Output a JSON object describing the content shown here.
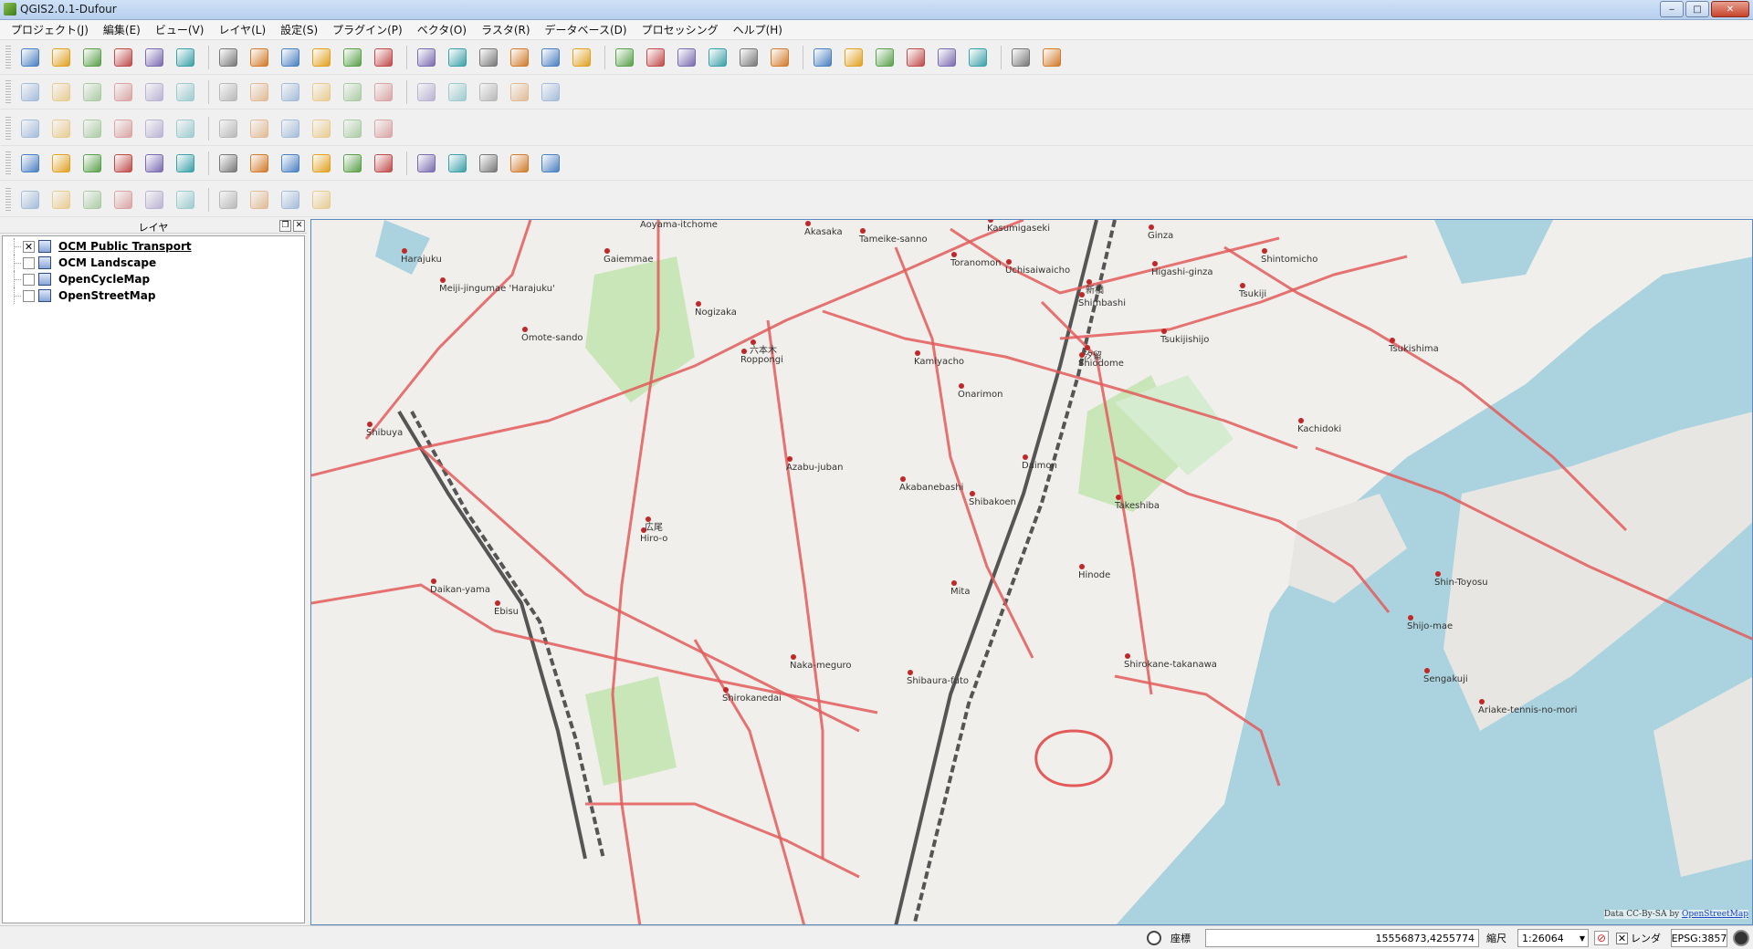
{
  "window": {
    "title": "QGIS2.0.1-Dufour",
    "minimize": "‒",
    "maximize": "□",
    "close": "✕"
  },
  "menu": [
    "プロジェクト(J)",
    "編集(E)",
    "ビュー(V)",
    "レイヤ(L)",
    "設定(S)",
    "プラグイン(P)",
    "ベクタ(O)",
    "ラスタ(R)",
    "データベース(D)",
    "プロセッシング",
    "ヘルプ(H)"
  ],
  "toolbar_icons": {
    "row1": [
      "new-project-icon",
      "open-project-icon",
      "save-project-icon",
      "save-as-icon",
      "new-print-composer-icon",
      "composer-manager-icon",
      "pan-to-selection-icon",
      "pan-icon",
      "touch-zoom-icon",
      "zoom-in-icon",
      "zoom-out-icon",
      "zoom-actual-icon",
      "zoom-full-icon",
      "zoom-to-selection-icon",
      "zoom-to-layer-icon",
      "zoom-last-icon",
      "zoom-next-icon",
      "refresh-icon",
      "identify-icon",
      "select-icon",
      "select-tools-icon",
      "deselect-icon",
      "field-calculator-icon",
      "attribute-table-icon",
      "statistics-icon",
      "measure-icon",
      "map-tips-icon",
      "new-bookmark-icon",
      "show-bookmarks-icon",
      "text-annotation-icon",
      "help-icon",
      "whats-this-icon"
    ],
    "row2": [
      "edits-icon",
      "toggle-editing-icon",
      "save-edits-icon",
      "add-feature-icon",
      "move-feature-icon",
      "node-tool-icon",
      "delete-selected-icon",
      "cut-features-icon",
      "copy-features-icon",
      "paste-features-icon",
      "label-icon",
      "layer-labeling-icon",
      "pin-labels-icon",
      "show-hide-labels-icon",
      "move-label-icon",
      "rotate-label-icon",
      "change-label-icon"
    ],
    "row3": [
      "raster-info-icon",
      "raster-hist-icon",
      "raster-stretch-icon",
      "raster-local-icon",
      "raster-bright-icon",
      "raster-dark-icon",
      "raster-contrast-icon",
      "raster-reduce-icon",
      "grid-icon",
      "sun-icon",
      "georeferencer-icon",
      "calculator-icon"
    ],
    "row4": [
      "add-vector-icon",
      "add-raster-icon",
      "add-postgis-icon",
      "add-spatialite-icon",
      "add-mssql-icon",
      "add-oracle-icon",
      "add-wms-icon",
      "add-wcs-icon",
      "add-wfs-icon",
      "add-delimited-icon",
      "new-shapefile-icon",
      "new-spatialite-icon",
      "gps-icon",
      "coordinate-capture-icon",
      "road-graph-icon",
      "globe-icon",
      "openlayers-icon"
    ],
    "row5": [
      "digitize-1-icon",
      "digitize-2-icon",
      "digitize-3-icon",
      "digitize-4-icon",
      "digitize-5-icon",
      "digitize-6-icon",
      "digitize-7-icon",
      "digitize-8-icon",
      "digitize-9-icon",
      "digitize-10-icon"
    ]
  },
  "layers_panel": {
    "title": "レイヤ",
    "layers": [
      {
        "name": "OCM Public Transport",
        "checked": true,
        "active": true
      },
      {
        "name": "OCM Landscape",
        "checked": false,
        "active": false
      },
      {
        "name": "OpenCycleMap",
        "checked": false,
        "active": false
      },
      {
        "name": "OpenStreetMap",
        "checked": false,
        "active": false
      }
    ]
  },
  "map": {
    "labels": [
      "Aoyama-itchome",
      "Akasaka",
      "Tameike-sanno",
      "Kasumigaseki",
      "Ginza",
      "Shintomicho",
      "Harajuku",
      "Gaiemmae",
      "Toranomon",
      "Uchisaiwaicho",
      "Higashi-ginza",
      "Meiji-jingumae 'Harajuku'",
      "Nogizaka",
      "Shimbashi",
      "Tsukiji",
      "Omote-sando",
      "Roppongi",
      "Tsukijishijo",
      "Tsukishima",
      "Kamiyacho",
      "Shiodome",
      "Onarimon",
      "Shibuya",
      "Kachidoki",
      "Azabu-juban",
      "Akabanebashi",
      "Daimon",
      "Shibakoen",
      "Takeshiba",
      "Hiro-o",
      "Hinode",
      "Mita",
      "Daikan-yama",
      "Shin-Toyosu",
      "Ebisu",
      "Shijo-mae",
      "Naka-meguro",
      "Shirokane-takanawa",
      "Shibaura-futo",
      "Sengakuji",
      "Ariake-tennis-no-mori",
      "Shirokanedai",
      "六本木",
      "新橋",
      "汐留",
      "広尾"
    ],
    "attribution_prefix": "Data CC-By-SA by ",
    "attribution_link": "OpenStreetMap"
  },
  "statusbar": {
    "coord_label": "座標",
    "coord_value": "15556873,4255774",
    "scale_label": "縮尺",
    "scale_value": "1:26064",
    "render_label": "レンダ",
    "render_checked": "✕",
    "crs": "EPSG:3857"
  },
  "colors": {
    "transit_line": "#e35a5a",
    "rail": "#555555",
    "water": "#aad3df",
    "park": "#c8e6b8",
    "land": "#f1efeb"
  }
}
